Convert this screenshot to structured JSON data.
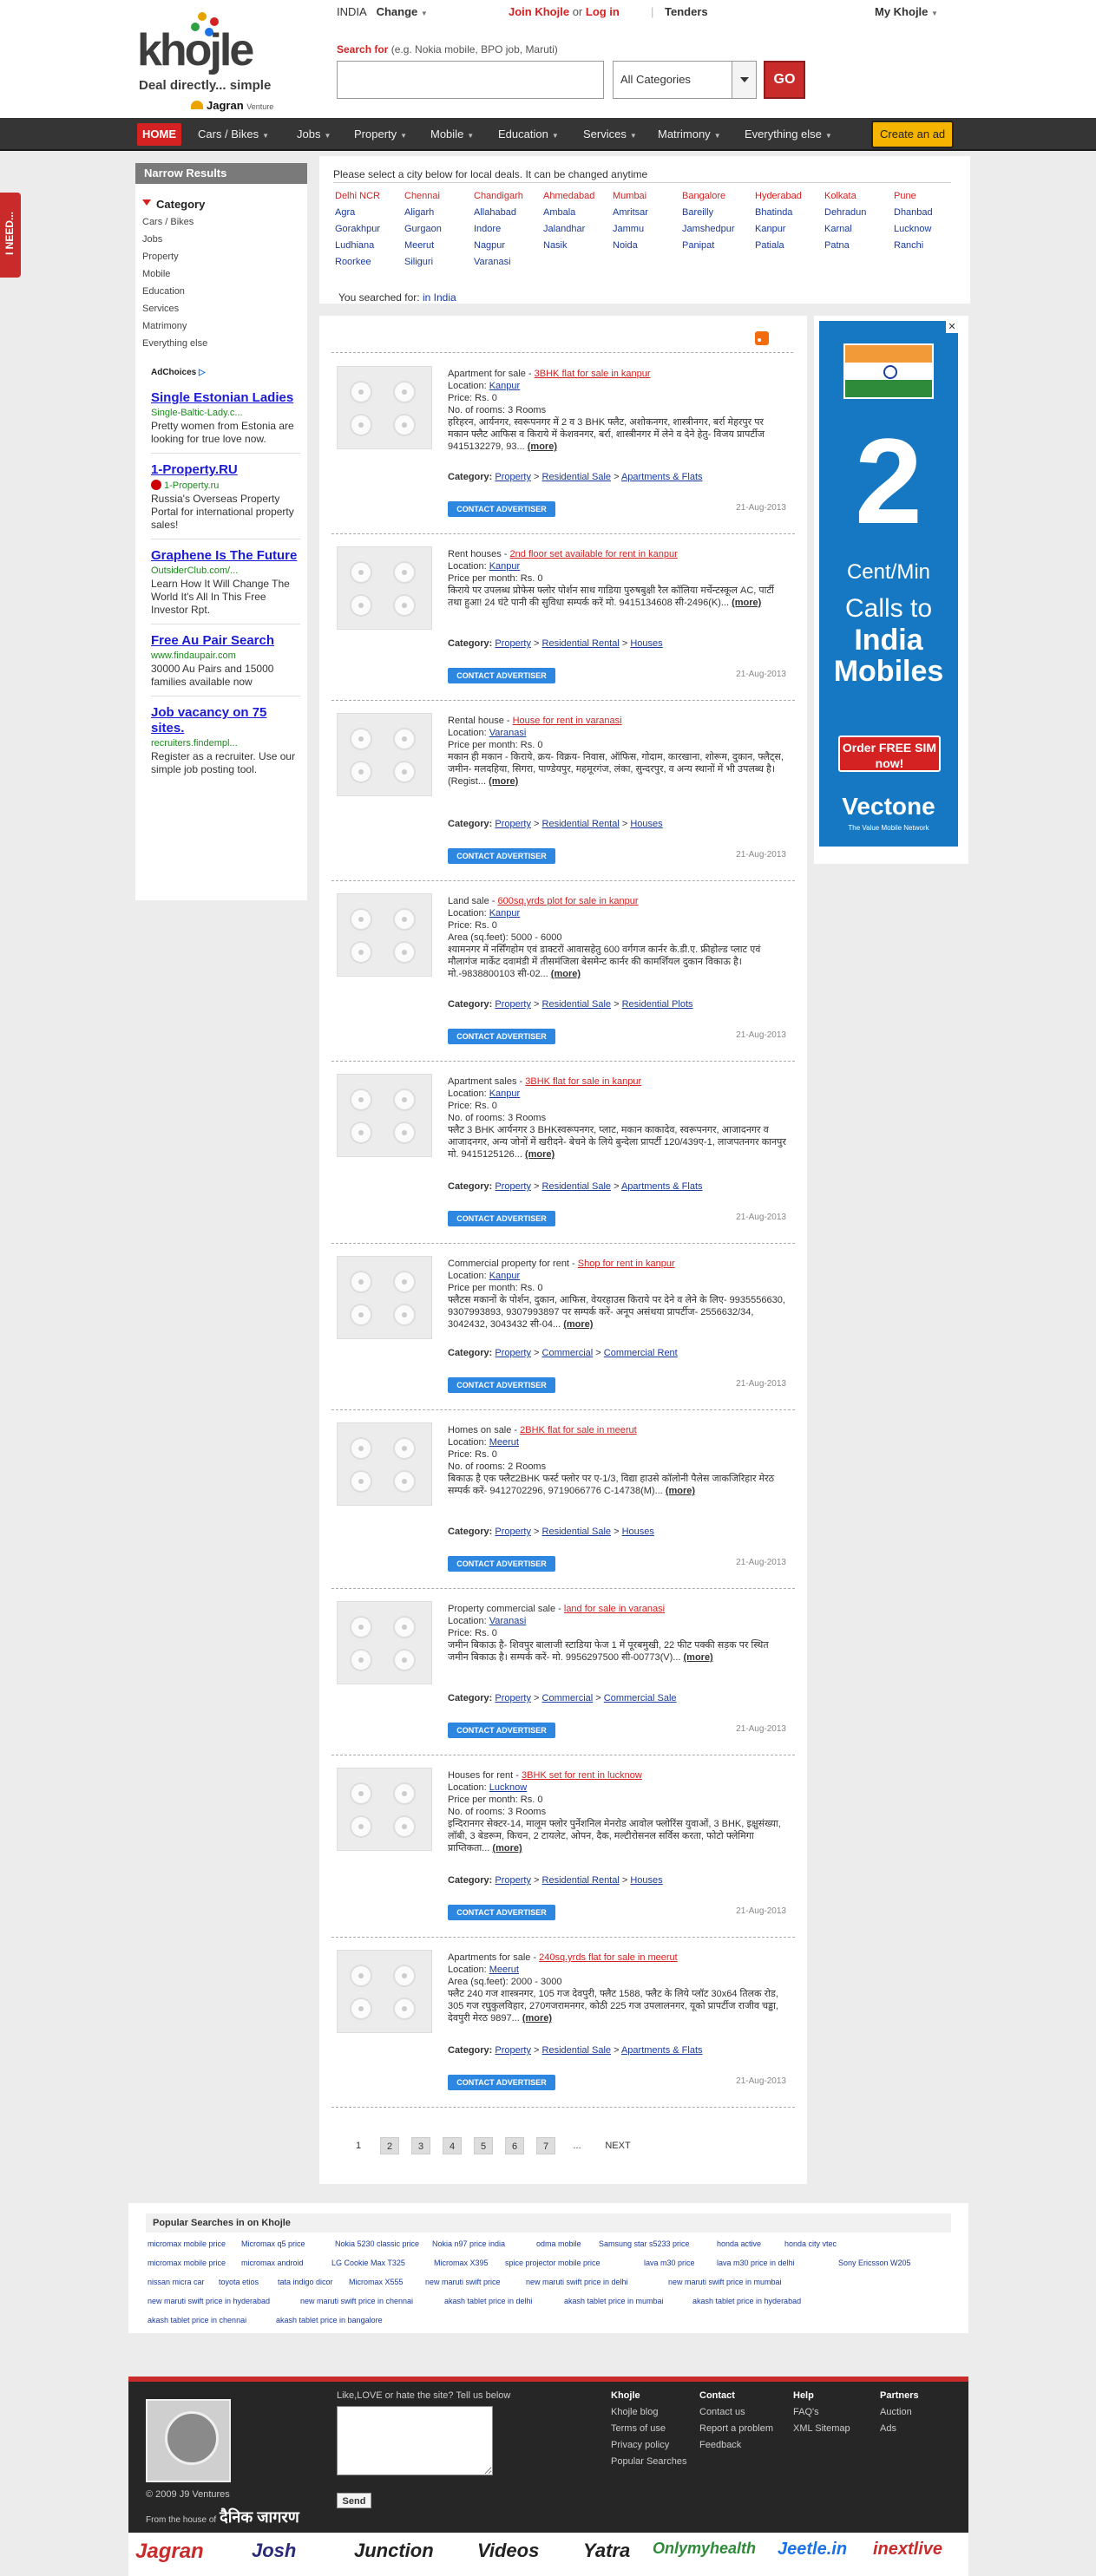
{
  "header": {
    "logo_text": "khojle",
    "tagline": "Deal directly... simple",
    "venture_brand": "Jagran",
    "venture_word": "Venture",
    "country": "INDIA",
    "change_label": "Change",
    "join_label": "Join Khojle",
    "or_label": "or",
    "login_label": "Log in",
    "tenders_label": "Tenders",
    "my_khojle_label": "My Khojle",
    "search_for_label": "Search for",
    "search_hint": "(e.g. Nokia mobile, BPO job, Maruti)",
    "search_value": "",
    "category_selected": "All Categories",
    "go_label": "GO"
  },
  "nav": {
    "home": "HOME",
    "items": [
      "Cars / Bikes",
      "Jobs",
      "Property",
      "Mobile",
      "Education",
      "Services",
      "Matrimony",
      "Everything else"
    ],
    "create_ad": "Create an ad"
  },
  "side_tab": "I NEED...",
  "sidebar": {
    "title": "Narrow Results",
    "category_label": "Category",
    "categories": [
      "Cars / Bikes",
      "Jobs",
      "Property",
      "Mobile",
      "Education",
      "Services",
      "Matrimony",
      "Everything else"
    ],
    "adchoices": "AdChoices",
    "ads": [
      {
        "title": "Single Estonian Ladies",
        "url": "Single-Baltic-Lady.c...",
        "desc": "Pretty women from Estonia are looking for true love now."
      },
      {
        "title": "1-Property.RU",
        "url": "1-Property.ru",
        "desc": "Russia's Overseas Property Portal for international property sales!"
      },
      {
        "title": "Graphene Is The Future",
        "url": "OutsiderClub.com/...",
        "desc": "Learn How It Will Change The World It's All In This Free Investor Rpt."
      },
      {
        "title": "Free Au Pair Search",
        "url": "www.findaupair.com",
        "desc": "30000 Au Pairs and 15000 families available now"
      },
      {
        "title": "Job vacancy on 75 sites.",
        "url": "recruiters.findempl...",
        "desc": "Register as a recruiter. Use our simple job posting tool."
      }
    ]
  },
  "cities": {
    "message": "Please select a city below for local deals. It can be changed anytime",
    "columns": [
      [
        "Delhi NCR",
        "Agra",
        "Gorakhpur",
        "Ludhiana",
        "Roorkee"
      ],
      [
        "Chennai",
        "Aligarh",
        "Gurgaon",
        "Meerut",
        "Siliguri"
      ],
      [
        "Chandigarh",
        "Allahabad",
        "Indore",
        "Nagpur",
        "Varanasi"
      ],
      [
        "Ahmedabad",
        "Ambala",
        "Jalandhar",
        "Nasik"
      ],
      [
        "Mumbai",
        "Amritsar",
        "Jammu",
        "Noida"
      ],
      [
        "Bangalore",
        "Bareilly",
        "Jamshedpur",
        "Panipat"
      ],
      [
        "Hyderabad",
        "Bhatinda",
        "Kanpur",
        "Patiala"
      ],
      [
        "Kolkata",
        "Dehradun",
        "Karnal",
        "Patna"
      ],
      [
        "Pune",
        "Dhanbad",
        "Lucknow",
        "Ranchi"
      ]
    ],
    "searched_label": "You searched for:",
    "searched_value": "in India"
  },
  "listing_labels": {
    "location": "Location:",
    "category": "Category:",
    "more": "(more)",
    "contact": "CONTACT ADVERTISER"
  },
  "listings": [
    {
      "type": "Apartment for sale - ",
      "title": "3BHK flat for sale in kanpur",
      "location": "Kanpur",
      "fields": [
        "Price: Rs. 0",
        "No. of rooms: 3 Rooms"
      ],
      "desc": "हरिहरन, आर्यनगर, स्वरूपनगर में 2 व 3 BHK फ्लैट, अशोकनगर, शास्त्रीनगर, बर्रा मेहरपुर पर मकान फ्लैट आफिस व किराये में केशवनगर, बर्रा, शास्त्रीनगर में लेने व देने हेतु- विजय प्रापर्टीज 9415132279, 93...",
      "cats": [
        "Property",
        "Residential Sale",
        "Apartments & Flats"
      ],
      "date": "21-Aug-2013"
    },
    {
      "type": "Rent houses - ",
      "title": "2nd floor set available for rent in kanpur",
      "location": "Kanpur",
      "fields": [
        "Price per month: Rs. 0"
      ],
      "desc": "किराये पर उपलब्ध प्रोफेस फ्लोर पोर्शन साथ गाडिया पुरुषबुक्षी रैल कॉलिया मर्चेन्टस्कूल AC, पार्टी तथा हुआ! 24 घंटे पानी की सुविधा सम्पर्क करें मो. 9415134608 सी-2496(K)...",
      "cats": [
        "Property",
        "Residential Rental",
        "Houses"
      ],
      "date": "21-Aug-2013"
    },
    {
      "type": "Rental house - ",
      "title": "House for rent in varanasi",
      "location": "Varanasi",
      "fields": [
        "Price per month: Rs. 0"
      ],
      "desc": "मकान ही मकान - किराये, क्रय- विक्रय- निवास, ऑफिस, गोदाम, कारखाना, शोरूम, दुकान, फ्लैट्स, जमीन- मलदहिया, सिगरा, पाण्डेयपुर, महमूरगंज, लंका, सुन्दरपुर, व अन्य स्थानों में भी उपलब्ध है। (Regist...",
      "cats": [
        "Property",
        "Residential Rental",
        "Houses"
      ],
      "date": "21-Aug-2013"
    },
    {
      "type": "Land sale - ",
      "title": "600sq.yrds plot for sale in kanpur",
      "location": "Kanpur",
      "fields": [
        "Price: Rs. 0",
        "Area (sq.feet): 5000 - 6000"
      ],
      "desc": "श्यामनगर में नर्सिंगहोम एवं डाक्टरों आवासहेतु 600 वर्गगज कार्नर के.डी.ए. फ्रीहोल्ड प्लाट एवं मौलागंज मार्केट दवामंडी में तीसमंजिला बेसमेन्ट कार्नर की कामर्शियल दुकान विकाऊ है। मो.-9838800103 सी-02...",
      "cats": [
        "Property",
        "Residential Sale",
        "Residential Plots"
      ],
      "date": "21-Aug-2013"
    },
    {
      "type": "Apartment sales - ",
      "title": "3BHK flat for sale in kanpur",
      "location": "Kanpur",
      "fields": [
        "Price: Rs. 0",
        "No. of rooms: 3 Rooms"
      ],
      "desc": "फ्लैट 3 BHK आर्यनगर 3 BHKस्वरूपनगर, प्लाट, मकान काकादेव, स्वरूपनगर, आजादनगर व आजादनगर, अन्य जोनों में खरीदने- बेचने के लिये बुन्देला प्रापर्टी 120/439ए-1, लाजपतनगर कानपुर मो. 9415125126...",
      "cats": [
        "Property",
        "Residential Sale",
        "Apartments & Flats"
      ],
      "date": "21-Aug-2013"
    },
    {
      "type": "Commercial property for rent - ",
      "title": "Shop for rent in kanpur",
      "location": "Kanpur",
      "fields": [
        "Price per month: Rs. 0"
      ],
      "desc": "फ्लैटस मकानों के पोर्शन, दुकान, आफिस, वेयरहाउस किराये पर देने व लेने के लिए- 9935556630, 9307993893, 9307993897 पर सम्पर्क करें- अनूप असंथया प्रापर्टीज- 2556632/34, 3042432, 3043432 सी-04...",
      "cats": [
        "Property",
        "Commercial",
        "Commercial Rent"
      ],
      "date": "21-Aug-2013"
    },
    {
      "type": "Homes on sale - ",
      "title": "2BHK flat for sale in meerut",
      "location": "Meerut",
      "fields": [
        "Price: Rs. 0",
        "No. of rooms: 2 Rooms"
      ],
      "desc": "बिकाऊ है एक फ्लैट2BHK फर्स्ट फ्लोर पर ए-1/3, विद्या हाउसे कॉलोनी पैलेस जाकजिरिहार मेरठ सम्पर्क करें- 9412702296, 9719066776 C-14738(M)...",
      "cats": [
        "Property",
        "Residential Sale",
        "Houses"
      ],
      "date": "21-Aug-2013"
    },
    {
      "type": "Property commercial sale - ",
      "title": "land for sale in varanasi",
      "location": "Varanasi",
      "fields": [
        "Price: Rs. 0"
      ],
      "desc": "जमीन बिकाऊ है- शिवपुर बालाजी स्टाडिया फेज 1 में पूरबमुखी, 22 फीट पक्की सड़क पर स्थित जमीन बिकाऊ है। सम्पर्क करें- मो. 9956297500 सी-00773(V)...",
      "cats": [
        "Property",
        "Commercial",
        "Commercial Sale"
      ],
      "date": "21-Aug-2013"
    },
    {
      "type": "Houses for rent - ",
      "title": "3BHK set for rent in lucknow",
      "location": "Lucknow",
      "fields": [
        "Price per month: Rs. 0",
        "No. of rooms: 3 Rooms"
      ],
      "desc": "इन्दिरानगर सेक्टर-14, मालूम फ्लोर पुर्नेशनिल मेनरोड आवोल फ्लोरिंस युवाओं, 3 BHK, इक्षुसंख्या, लॉबी, 3 बेडरूम, किचन, 2 टायलेट, ओपन, दैक, मल्टीरोसनल सर्विस करता, फोटो फ्लेमिगा प्राप्तिकता...",
      "cats": [
        "Property",
        "Residential Rental",
        "Houses"
      ],
      "date": "21-Aug-2013"
    },
    {
      "type": "Apartments for sale - ",
      "title": "240sq.yrds flat for sale in meerut",
      "location": "Meerut",
      "fields": [
        "Area (sq.feet): 2000 - 3000"
      ],
      "desc": "फ्लैट 240 गज शास्त्रनगर, 105 गज देवपुरी, फ्लैट 1588, फ्लैट के लिये प्लॉट 30x64 तिलक रोड, 305 गज रघुकुलविहार, 270गजरामनगर, कोठी 225 गज उपलालनगर, यूको प्रापर्टीज राजीव चड्ढा, देवपुरी मेरठ 9897...",
      "cats": [
        "Property",
        "Residential Sale",
        "Apartments & Flats"
      ],
      "date": "21-Aug-2013"
    }
  ],
  "pagination": {
    "pages": [
      "1",
      "2",
      "3",
      "4",
      "5",
      "6",
      "7"
    ],
    "ellipsis": "...",
    "next": "NEXT"
  },
  "right_ad": {
    "close": "✕",
    "big_number": "2",
    "cent_text": "Cent/Min",
    "calls_to": "Calls to",
    "india_mobiles_1": "India",
    "india_mobiles_2": "Mobiles",
    "order": "Order FREE SIM now!",
    "brand": "Vectone",
    "brand_sub": "The Value Mobile Network"
  },
  "popular": {
    "title": "Popular Searches in on Khojle",
    "links": [
      "micromax mobile price",
      "Micromax q5 price",
      "Nokia 5230 classic price",
      "Nokia n97 price india",
      "odma mobile",
      "Samsung star s5233 price",
      "honda active",
      "honda city vtec",
      "micromax mobile price",
      "micromax android",
      "LG Cookie Max T325",
      "Micromax X395",
      "spice projector mobile price",
      "lava m30 price",
      "lava m30 price in delhi",
      "Sony Ericsson W205",
      "nissan micra car",
      "toyota etios",
      "tata indigo dicor",
      "Micromax X555",
      "new maruti swift price",
      "new maruti swift price in delhi",
      "new maruti swift price in mumbai",
      "new maruti swift price in hyderabad",
      "new maruti swift price in chennai",
      "akash tablet price in delhi",
      "akash tablet price in mumbai",
      "akash tablet price in hyderabad",
      "akash tablet price in chennai",
      "akash tablet price in bangalore"
    ]
  },
  "footer": {
    "copyright": "© 2009 J9 Ventures",
    "from_house": "From the house of",
    "house_name": "दैनिक जागरण",
    "feedback_q": "Like,LOVE or hate the site? Tell us below",
    "send": "Send",
    "cols": [
      {
        "h": "Khojle",
        "items": [
          "Khojle blog",
          "Terms of use",
          "Privacy policy",
          "Popular Searches"
        ]
      },
      {
        "h": "Contact",
        "items": [
          "Contact us",
          "Report a problem",
          "Feedback"
        ]
      },
      {
        "h": "Help",
        "items": [
          "FAQ's",
          "XML Sitemap"
        ]
      },
      {
        "h": "Partners",
        "items": [
          "Auction",
          "Ads"
        ]
      }
    ]
  },
  "brands": [
    "Jagran",
    "Josh",
    "Junction",
    "Videos",
    "Yatra",
    "Onlymyhealth",
    "Jeetle.in",
    "inextlive"
  ]
}
